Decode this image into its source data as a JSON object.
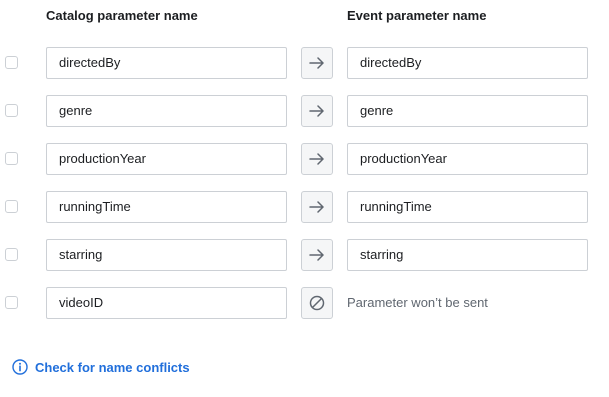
{
  "headers": {
    "catalog": "Catalog parameter name",
    "event": "Event parameter name"
  },
  "rows": [
    {
      "source": "directedBy",
      "target": "directedBy",
      "mapping": "arrow",
      "checked": false
    },
    {
      "source": "genre",
      "target": "genre",
      "mapping": "arrow",
      "checked": false
    },
    {
      "source": "productionYear",
      "target": "productionYear",
      "mapping": "arrow",
      "checked": false
    },
    {
      "source": "runningTime",
      "target": "runningTime",
      "mapping": "arrow",
      "checked": false
    },
    {
      "source": "starring",
      "target": "starring",
      "mapping": "arrow",
      "checked": false
    },
    {
      "source": "videoID",
      "target": "Parameter won’t be sent",
      "mapping": "blocked",
      "checked": false
    }
  ],
  "conflict_link": {
    "label": "Check for name conflicts",
    "icon": "info-icon"
  },
  "colors": {
    "link": "#216fdb",
    "border": "#ccd0d5",
    "muted_text": "#606770",
    "button_bg": "#f5f6f7"
  }
}
